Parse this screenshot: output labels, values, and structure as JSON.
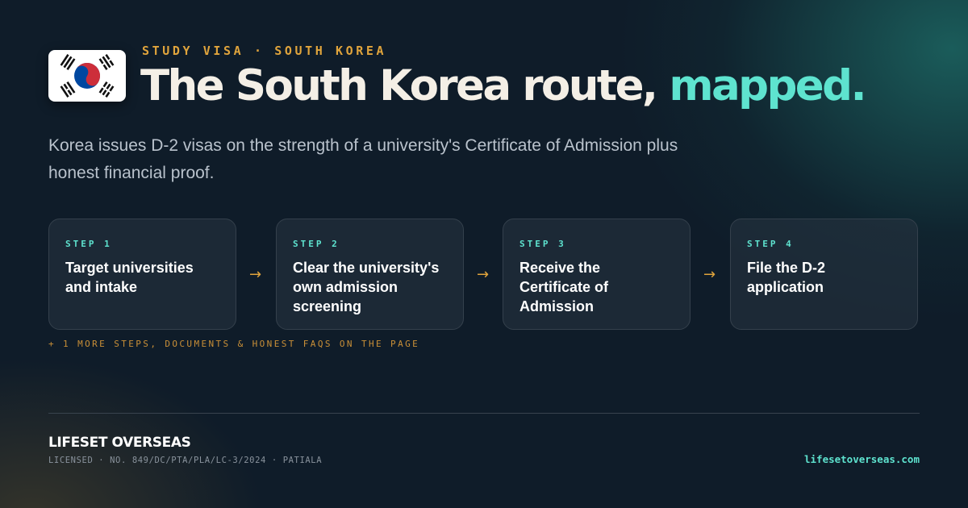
{
  "flag": {
    "name": "south-korea-flag-icon"
  },
  "header": {
    "eyebrow": "STUDY VISA · SOUTH KOREA",
    "title_main": "The South Korea route,",
    "title_accent": "mapped."
  },
  "subtitle": "Korea issues D-2 visas on the strength of a university's Certificate of Admission plus honest financial proof.",
  "steps": [
    {
      "label": "STEP 1",
      "text": "Target universities and intake"
    },
    {
      "label": "STEP 2",
      "text": "Clear the university's own admission screening"
    },
    {
      "label": "STEP 3",
      "text": "Receive the Certificate of Admission"
    },
    {
      "label": "STEP 4",
      "text": "File the D-2 application"
    }
  ],
  "arrow_glyph": "→",
  "more_note": "+ 1 MORE STEPS, DOCUMENTS & HONEST FAQS ON THE PAGE",
  "footer": {
    "brand": "LIFESET OVERSEAS",
    "license": "LICENSED · NO. 849/DC/PTA/PLA/LC-3/2024 · PATIALA",
    "website": "lifesetoverseas.com"
  },
  "colors": {
    "accent_teal": "#5ee3cf",
    "accent_amber": "#e0a43c",
    "background": "#0f1c29",
    "flag_red": "#cd2e3a",
    "flag_blue": "#0047a0"
  }
}
